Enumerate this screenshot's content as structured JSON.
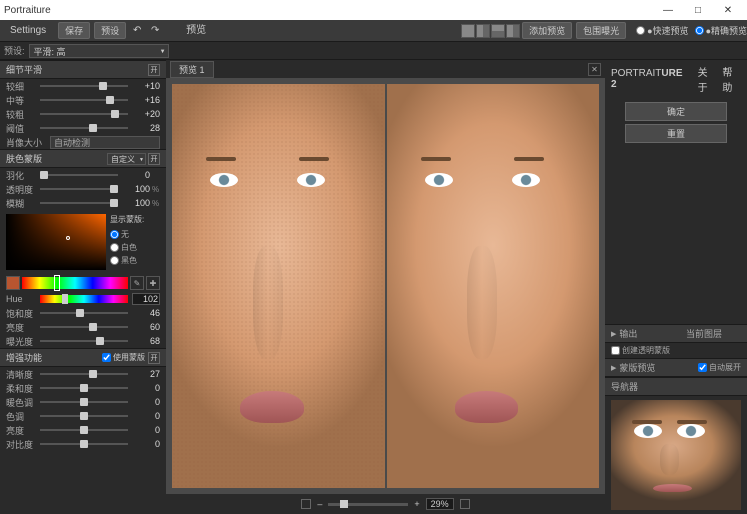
{
  "title": "Portraiture",
  "window": {
    "min": "—",
    "max": "□",
    "close": "✕"
  },
  "toolbar": {
    "settings": "Settings",
    "save": "保存",
    "preset_btn": "预设",
    "preview": "预览",
    "add_preview": "添加预览",
    "bracket": "包围曝光",
    "quick": "●快速预览",
    "accurate": "●精确预览"
  },
  "preset": {
    "label": "预设:",
    "value": "平滑: 高",
    "tab_label": "预览 1"
  },
  "detail": {
    "header": "细节平滑",
    "rows": [
      {
        "label": "较细",
        "value": "+10",
        "pos": 72
      },
      {
        "label": "中等",
        "value": "+16",
        "pos": 80
      },
      {
        "label": "较粗",
        "value": "+20",
        "pos": 85
      },
      {
        "label": "阈值",
        "value": "28",
        "pos": 60
      }
    ],
    "size_label": "肖像大小",
    "size_value": "自动检测"
  },
  "mask": {
    "header": "肤色蒙版",
    "mode": "自定义",
    "rows": [
      {
        "label": "羽化",
        "value": "0",
        "pos": 5,
        "pct": ""
      },
      {
        "label": "透明度",
        "value": "100",
        "pos": 95,
        "pct": "%"
      },
      {
        "label": "模糊",
        "value": "100",
        "pos": 95,
        "pct": "%"
      }
    ],
    "show_label": "显示蒙版:",
    "radios": [
      "无",
      "白色",
      "黑色"
    ],
    "hue_label": "Hue",
    "hue_value": "102",
    "extra": [
      {
        "label": "饱和度",
        "value": "46",
        "pos": 46
      },
      {
        "label": "亮度",
        "value": "60",
        "pos": 60
      },
      {
        "label": "曝光度",
        "value": "68",
        "pos": 68
      }
    ]
  },
  "enhance": {
    "header": "增强功能",
    "use_mask": "使用蒙版",
    "rows": [
      {
        "label": "清晰度",
        "value": "27",
        "pos": 60
      },
      {
        "label": "柔和度",
        "value": "0",
        "pos": 50
      },
      {
        "label": "暖色调",
        "value": "0",
        "pos": 50
      },
      {
        "label": "色调",
        "value": "0",
        "pos": 50
      },
      {
        "label": "亮度",
        "value": "0",
        "pos": 50
      },
      {
        "label": "对比度",
        "value": "0",
        "pos": 50
      }
    ]
  },
  "bottom": {
    "zoom": "29%",
    "plus": "+",
    "minus": "–"
  },
  "right": {
    "brand1": "PORTRAIT",
    "brand2": "URE 2",
    "about": "关于",
    "help": "帮助",
    "ok": "确定",
    "reset": "重置",
    "output": "输出",
    "output_dd": "当前图层",
    "create_mask": "创建透明蒙版",
    "mask_preview": "蒙版预览",
    "auto_expand": "自动展开",
    "navigator": "导航器"
  }
}
